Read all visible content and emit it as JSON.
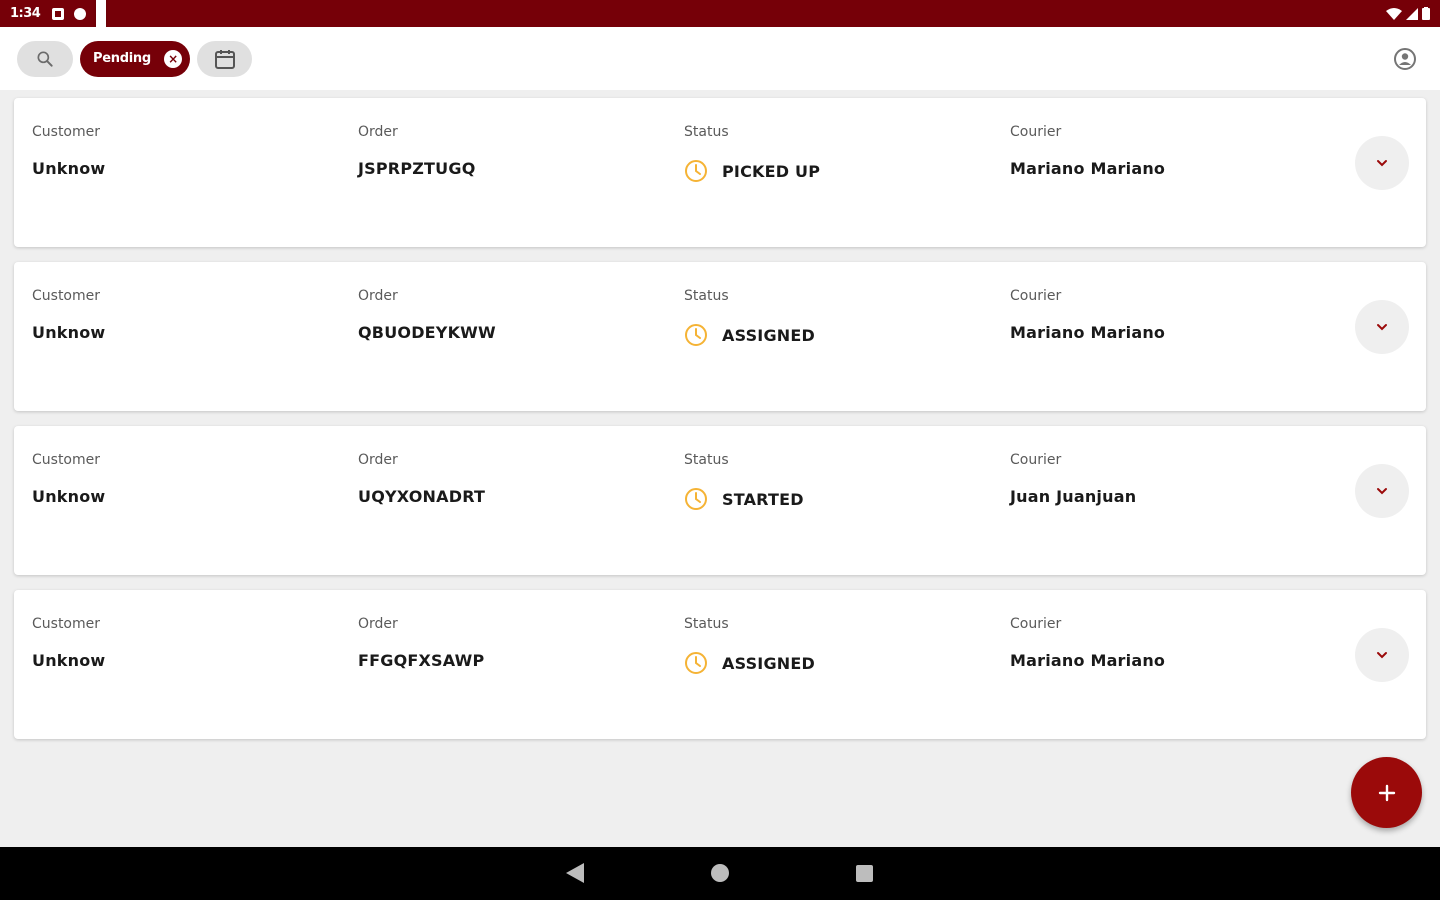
{
  "status_bar": {
    "time": "1:34"
  },
  "filters": {
    "pending_chip_label": "Pending",
    "pending_chip_clear": "×"
  },
  "columns": {
    "customer": "Customer",
    "order": "Order",
    "status": "Status",
    "courier": "Courier"
  },
  "orders": [
    {
      "customer": "Unknow",
      "order": "JSPRPZTUGQ",
      "status": "PICKED UP",
      "courier": "Mariano Mariano"
    },
    {
      "customer": "Unknow",
      "order": "QBUODEYKWW",
      "status": "ASSIGNED",
      "courier": "Mariano Mariano"
    },
    {
      "customer": "Unknow",
      "order": "UQYXONADRT",
      "status": "STARTED",
      "courier": "Juan Juanjuan"
    },
    {
      "customer": "Unknow",
      "order": "FFGQFXSAWP",
      "status": "ASSIGNED",
      "courier": "Mariano Mariano"
    }
  ],
  "fab": {
    "label": "+"
  },
  "colors": {
    "primary": "#760008",
    "status_clock": "#f5b335",
    "background": "#efefef"
  },
  "icons": {
    "search": "search-icon",
    "calendar": "calendar-icon",
    "account": "account-circle-icon",
    "status": "clock-icon",
    "expand": "chevron-down-icon",
    "add": "plus-icon"
  }
}
